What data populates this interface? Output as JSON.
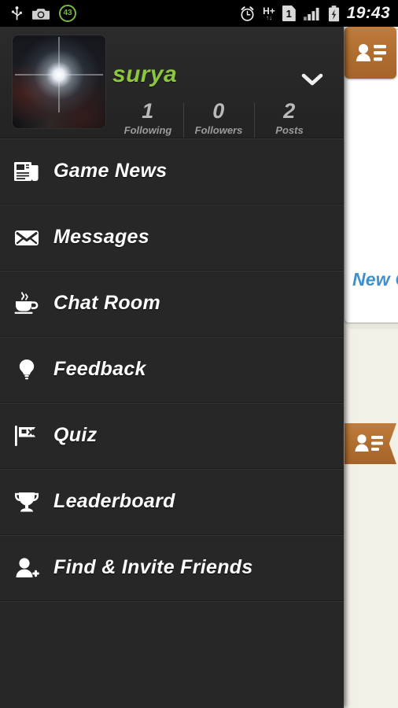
{
  "statusbar": {
    "left_icons": [
      "usb-icon",
      "camera-icon",
      "battery-percent-badge"
    ],
    "battery_percent": "43",
    "right_icons": [
      "alarm-clock-icon",
      "hspa-plus-data-icon",
      "sim-1-icon",
      "signal-bars-icon",
      "battery-charging-icon"
    ],
    "network_type": "H+",
    "sim_slot": "1",
    "time": "19:43"
  },
  "profile": {
    "username": "surya",
    "avatar_alt": "night-sky-photo-avatar",
    "expand_icon": "chevron-down-icon",
    "stats": [
      {
        "value": "1",
        "label": "Following"
      },
      {
        "value": "0",
        "label": "Followers"
      },
      {
        "value": "2",
        "label": "Posts"
      }
    ]
  },
  "menu": {
    "items": [
      {
        "label": "Game News",
        "icon": "newspaper-icon"
      },
      {
        "label": "Messages",
        "icon": "envelope-icon"
      },
      {
        "label": "Chat Room",
        "icon": "coffee-cup-icon"
      },
      {
        "label": "Feedback",
        "icon": "lightbulb-icon"
      },
      {
        "label": "Quiz",
        "icon": "flag-icon"
      },
      {
        "label": "Leaderboard",
        "icon": "trophy-icon"
      },
      {
        "label": "Find & Invite Friends",
        "icon": "person-add-icon"
      }
    ]
  },
  "background_app": {
    "card_heading": "New Ga",
    "contacts_button_icon": "contact-list-icon",
    "contacts_ribbon_icon": "contact-list-icon"
  },
  "colors": {
    "drawer_bg": "#272727",
    "username_green": "#8cc63e",
    "accent_orange": "#b06f30",
    "heading_blue": "#3d8fce",
    "statusbar_bg": "#000000",
    "page_bg": "#f2f1e8"
  }
}
